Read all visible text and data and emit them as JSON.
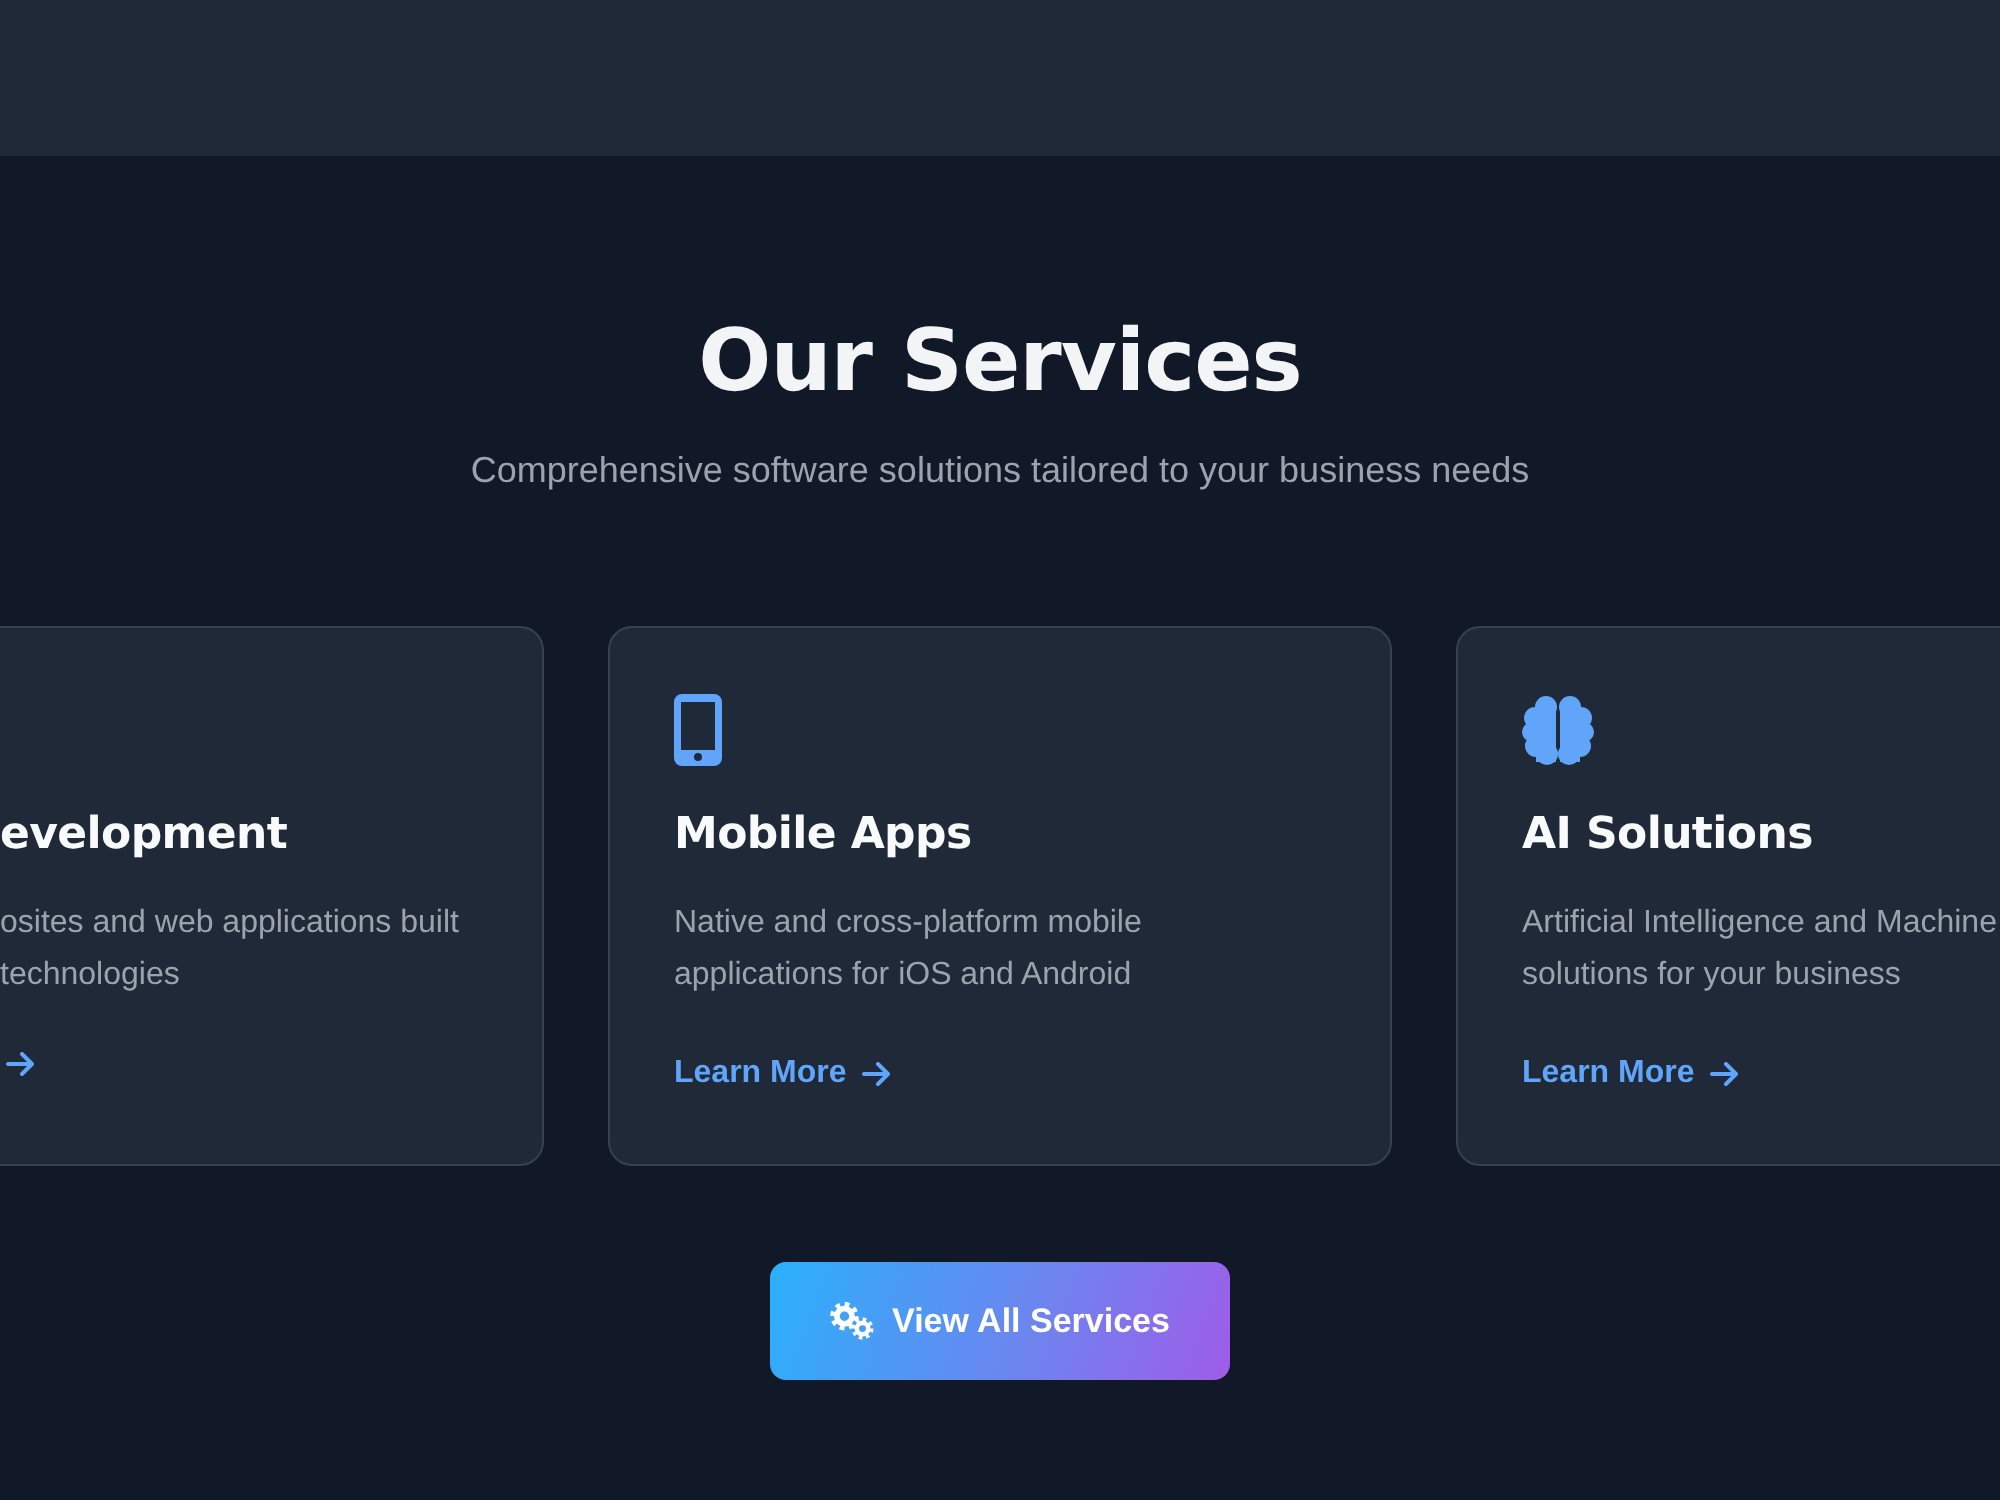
{
  "section": {
    "title": "Our Services",
    "subtitle": "Comprehensive software solutions tailored to your business needs"
  },
  "cards": [
    {
      "title": "evelopment",
      "description_lines": [
        "osites and web applications built",
        "technologies"
      ]
    },
    {
      "title": "Mobile Apps",
      "description_lines": [
        "Native and cross-platform mobile",
        "applications for iOS and Android"
      ],
      "link": "Learn More"
    },
    {
      "title": "AI Solutions",
      "description_lines": [
        "Artificial Intelligence and Machine",
        "solutions for your business"
      ],
      "link": "Learn More"
    }
  ],
  "button": {
    "label": "View All Services"
  }
}
